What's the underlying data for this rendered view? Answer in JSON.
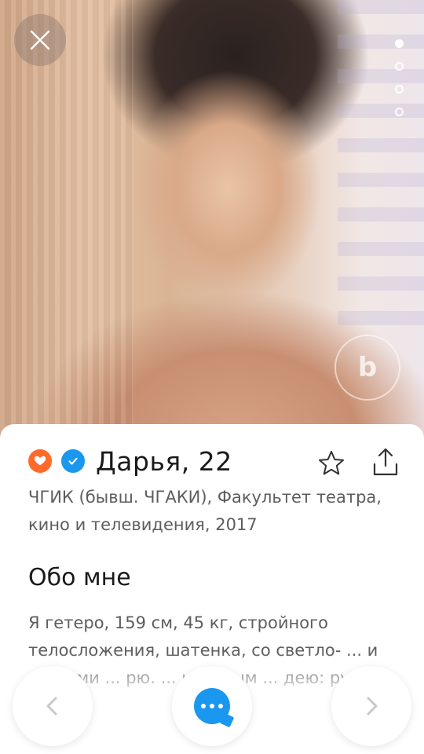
{
  "profile": {
    "name_age": "Дарья, 22",
    "education": "ЧГИК (бывш. ЧГАКИ), Факультет театра, кино и телевидения, 2017"
  },
  "about": {
    "title": "Обо мне",
    "text": "Я гетеро, 159 см, 45 кг, стройного телосложения, шатенка, со светло- ... и глазами ... рю. ... которым ... дею: рус..."
  },
  "photo": {
    "watermark": "b",
    "page_count": 4,
    "active_index": 0
  },
  "colors": {
    "accent_blue": "#1a97ee",
    "badge_orange": "#ff6a2b"
  },
  "icons": {
    "close": "close-icon",
    "star": "star-icon",
    "share": "share-icon",
    "prev": "chevron-left-icon",
    "next": "chevron-right-icon",
    "chat": "chat-icon"
  }
}
